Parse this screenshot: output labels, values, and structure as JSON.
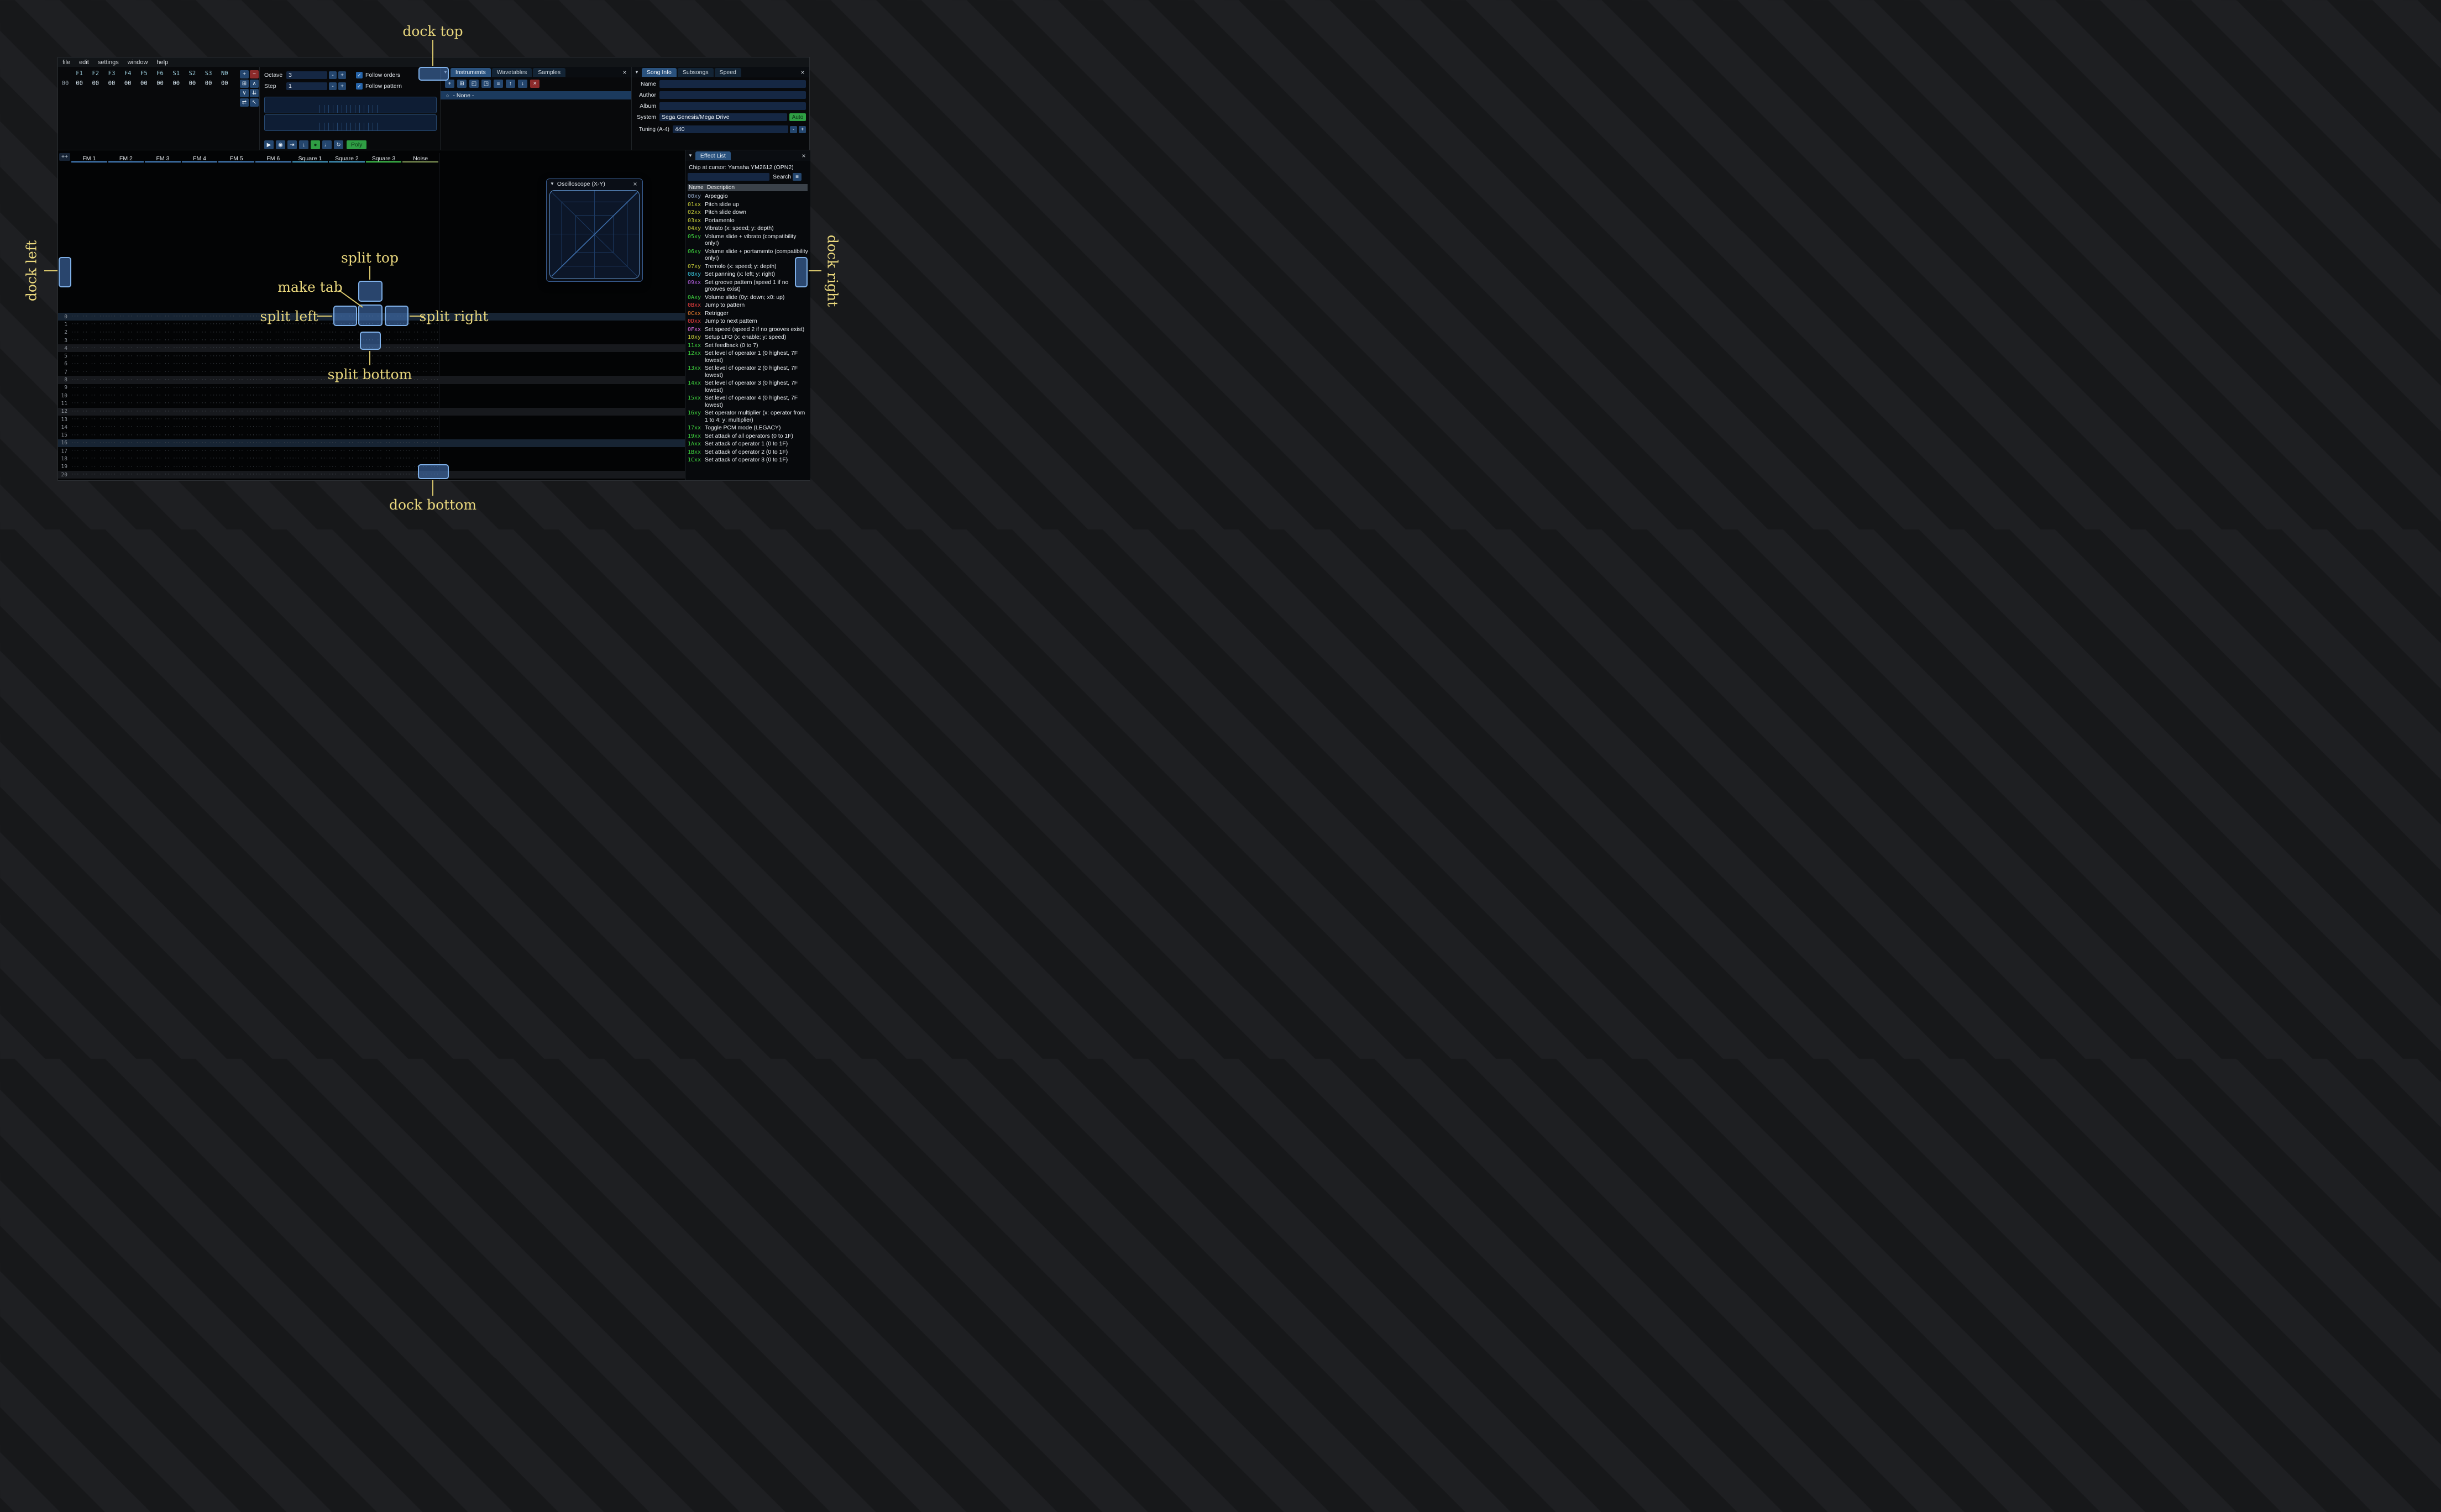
{
  "menu": {
    "items": [
      "file",
      "edit",
      "settings",
      "window",
      "help"
    ]
  },
  "icons": {
    "collapse": "▼",
    "close": "×",
    "radio": "○",
    "check": "✓",
    "menu": "≡"
  },
  "steppers": {
    "minus": "-",
    "plus": "+"
  },
  "orders": {
    "channel_headers": [
      "F1",
      "F2",
      "F3",
      "F4",
      "F5",
      "F6",
      "S1",
      "S2",
      "S3",
      "N0"
    ],
    "row_index": "00",
    "row_values": [
      "00",
      "00",
      "00",
      "00",
      "00",
      "00",
      "00",
      "00",
      "00",
      "00"
    ],
    "buttons": [
      {
        "name": "order-add",
        "glyph": "+",
        "variant": ""
      },
      {
        "name": "order-remove",
        "glyph": "−",
        "variant": "red"
      },
      {
        "name": "order-duplicate",
        "glyph": "⊞",
        "variant": ""
      },
      {
        "name": "order-move-up",
        "glyph": "∧",
        "variant": ""
      },
      {
        "name": "order-move-down",
        "glyph": "∨",
        "variant": ""
      },
      {
        "name": "order-duplicate-to-end",
        "glyph": "⇊",
        "variant": ""
      },
      {
        "name": "order-change-all",
        "glyph": "⇄",
        "variant": ""
      },
      {
        "name": "order-edit-mode",
        "glyph": "↖",
        "variant": ""
      }
    ]
  },
  "play": {
    "octave_label": "Octave",
    "octave_value": "3",
    "step_label": "Step",
    "step_value": "1",
    "follow_orders_label": "Follow orders",
    "follow_pattern_label": "Follow pattern",
    "transport": [
      {
        "name": "play",
        "glyph": "▶",
        "variant": ""
      },
      {
        "name": "play-pattern",
        "glyph": "◉",
        "variant": ""
      },
      {
        "name": "play-from-cursor",
        "glyph": "⇥",
        "variant": ""
      },
      {
        "name": "step-one-row",
        "glyph": "↓",
        "variant": ""
      },
      {
        "name": "edit-record",
        "glyph": "●",
        "variant": "green"
      },
      {
        "name": "metronome",
        "glyph": "♩",
        "variant": ""
      },
      {
        "name": "repeat-pattern",
        "glyph": "↻",
        "variant": ""
      }
    ],
    "poly_label": "Poly"
  },
  "instruments": {
    "tabs": [
      "Instruments",
      "Wavetables",
      "Samples"
    ],
    "active_tab": "Instruments",
    "toolbar": [
      {
        "name": "instrument-add",
        "glyph": "+",
        "variant": ""
      },
      {
        "name": "instrument-duplicate",
        "glyph": "⊞",
        "variant": ""
      },
      {
        "name": "instrument-open",
        "glyph": "◰",
        "variant": ""
      },
      {
        "name": "instrument-save",
        "glyph": "◳",
        "variant": ""
      },
      {
        "name": "instrument-folder-view",
        "glyph": "≡",
        "variant": ""
      },
      {
        "name": "instrument-move-up",
        "glyph": "↑",
        "variant": ""
      },
      {
        "name": "instrument-move-down",
        "glyph": "↓",
        "variant": ""
      },
      {
        "name": "instrument-delete",
        "glyph": "×",
        "variant": "red"
      }
    ],
    "items": [
      "- None -"
    ]
  },
  "song_info": {
    "tabs": [
      "Song Info",
      "Subsongs",
      "Speed"
    ],
    "active_tab": "Song Info",
    "fields": [
      {
        "label": "Name",
        "value": ""
      },
      {
        "label": "Author",
        "value": ""
      },
      {
        "label": "Album",
        "value": ""
      },
      {
        "label": "System",
        "value": "Sega Genesis/Mega Drive"
      },
      {
        "label": "Tuning (A-4)",
        "value": "440"
      }
    ],
    "auto_button": "Auto"
  },
  "pattern": {
    "expand_button": "++",
    "row_count": 22,
    "empty_cell": "··· ·· ·· ···",
    "channels": [
      {
        "name": "FM 1",
        "color": "#4a87c9"
      },
      {
        "name": "FM 2",
        "color": "#4a87c9"
      },
      {
        "name": "FM 3",
        "color": "#4a87c9"
      },
      {
        "name": "FM 4",
        "color": "#4a87c9"
      },
      {
        "name": "FM 5",
        "color": "#4a87c9"
      },
      {
        "name": "FM 6",
        "color": "#4a87c9"
      },
      {
        "name": "Square 1",
        "color": "#49a8d4"
      },
      {
        "name": "Square 2",
        "color": "#49a8d4"
      },
      {
        "name": "Square 3",
        "color": "#45d453"
      },
      {
        "name": "Noise",
        "color": "#89a05c"
      }
    ]
  },
  "oscilloscope": {
    "title": "Oscilloscope (X-Y)"
  },
  "effect_list": {
    "tab": "Effect List",
    "chip_label": "Chip at cursor: Yamaha YM2612 (OPN2)",
    "search_label": "Search",
    "columns": [
      "Name",
      "Description"
    ],
    "effects": [
      {
        "code": "00xy",
        "color": "#93a9c9",
        "desc": "Arpeggio"
      },
      {
        "code": "01xx",
        "color": "#c9cf3a",
        "desc": "Pitch slide up"
      },
      {
        "code": "02xx",
        "color": "#c9cf3a",
        "desc": "Pitch slide down"
      },
      {
        "code": "03xx",
        "color": "#c9cf3a",
        "desc": "Portamento"
      },
      {
        "code": "04xy",
        "color": "#c9cf3a",
        "desc": "Vibrato (x: speed; y: depth)"
      },
      {
        "code": "05xy",
        "color": "#3ed43e",
        "desc": "Volume slide + vibrato (compatibility only!)"
      },
      {
        "code": "06xy",
        "color": "#3ed43e",
        "desc": "Volume slide + portamento (compatibility only!)"
      },
      {
        "code": "07xy",
        "color": "#c9cf3a",
        "desc": "Tremolo (x: speed; y: depth)"
      },
      {
        "code": "08xy",
        "color": "#38c6dc",
        "desc": "Set panning (x: left; y: right)"
      },
      {
        "code": "09xx",
        "color": "#b45fe0",
        "desc": "Set groove pattern (speed 1 if no grooves exist)"
      },
      {
        "code": "0Axy",
        "color": "#3ed43e",
        "desc": "Volume slide (0y: down; x0: up)"
      },
      {
        "code": "0Bxx",
        "color": "#ef4040",
        "desc": "Jump to pattern"
      },
      {
        "code": "0Cxx",
        "color": "#ef8030",
        "desc": "Retrigger"
      },
      {
        "code": "0Dxx",
        "color": "#ef4040",
        "desc": "Jump to next pattern"
      },
      {
        "code": "0Fxx",
        "color": "#df6ee8",
        "desc": "Set speed (speed 2 if no grooves exist)"
      },
      {
        "code": "10xy",
        "color": "#c9cf3a",
        "desc": "Setup LFO (x: enable; y: speed)"
      },
      {
        "code": "11xx",
        "color": "#3ed43e",
        "desc": "Set feedback (0 to 7)"
      },
      {
        "code": "12xx",
        "color": "#3ed43e",
        "desc": "Set level of operator 1 (0 highest, 7F lowest)"
      },
      {
        "code": "13xx",
        "color": "#3ed43e",
        "desc": "Set level of operator 2 (0 highest, 7F lowest)"
      },
      {
        "code": "14xx",
        "color": "#3ed43e",
        "desc": "Set level of operator 3 (0 highest, 7F lowest)"
      },
      {
        "code": "15xx",
        "color": "#3ed43e",
        "desc": "Set level of operator 4 (0 highest, 7F lowest)"
      },
      {
        "code": "16xy",
        "color": "#3ed43e",
        "desc": "Set operator multiplier (x: operator from 1 to 4; y: multiplier)"
      },
      {
        "code": "17xx",
        "color": "#3ed43e",
        "desc": "Toggle PCM mode (LEGACY)"
      },
      {
        "code": "19xx",
        "color": "#3ed43e",
        "desc": "Set attack of all operators (0 to 1F)"
      },
      {
        "code": "1Axx",
        "color": "#3ed43e",
        "desc": "Set attack of operator 1 (0 to 1F)"
      },
      {
        "code": "1Bxx",
        "color": "#3ed43e",
        "desc": "Set attack of operator 2 (0 to 1F)"
      },
      {
        "code": "1Cxx",
        "color": "#3ed43e",
        "desc": "Set attack of operator 3 (0 to 1F)"
      }
    ]
  },
  "overlay": {
    "dock_top": "dock top",
    "dock_bottom": "dock bottom",
    "dock_left": "dock left",
    "dock_right": "dock right",
    "split_top": "split top",
    "split_bottom": "split bottom",
    "split_left": "split left",
    "split_right": "split right",
    "make_tab": "make tab"
  }
}
